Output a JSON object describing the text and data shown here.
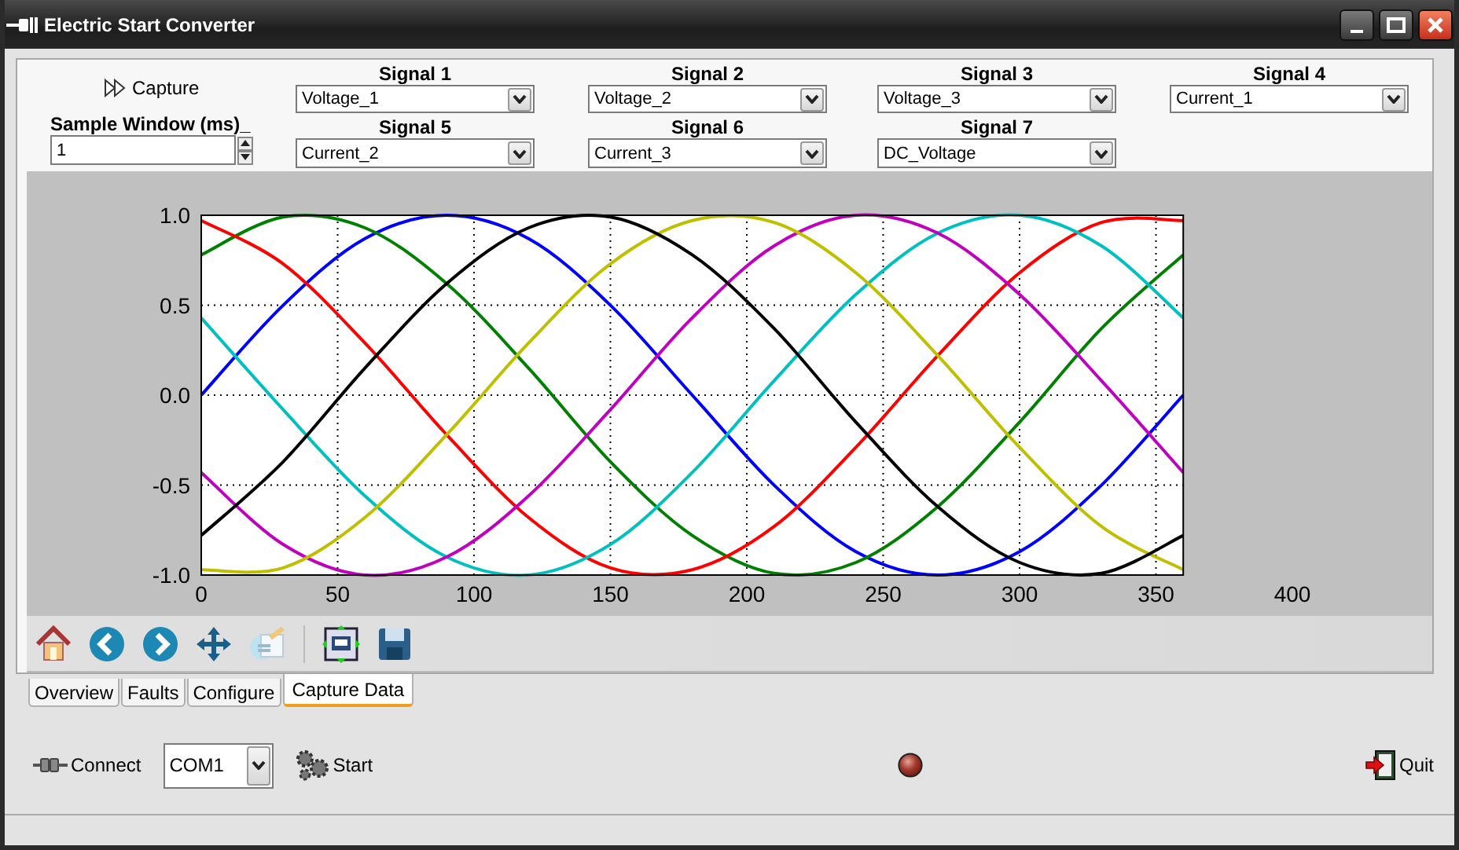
{
  "window": {
    "title": "Electric Start Converter"
  },
  "capture": {
    "label": "Capture"
  },
  "sample_window": {
    "label": "Sample Window (ms)_",
    "value": "1"
  },
  "signals": [
    {
      "label": "Signal 1",
      "value": "Voltage_1"
    },
    {
      "label": "Signal 2",
      "value": "Voltage_2"
    },
    {
      "label": "Signal 3",
      "value": "Voltage_3"
    },
    {
      "label": "Signal 4",
      "value": "Current_1"
    },
    {
      "label": "Signal 5",
      "value": "Current_2"
    },
    {
      "label": "Signal 6",
      "value": "Current_3"
    },
    {
      "label": "Signal 7",
      "value": "DC_Voltage"
    }
  ],
  "chart_data": {
    "type": "line",
    "grid": true,
    "x": [
      0,
      30,
      60,
      90,
      120,
      150,
      180,
      210,
      240,
      270,
      300,
      330,
      360
    ],
    "xlim": [
      0,
      400
    ],
    "ylim": [
      -1,
      1
    ],
    "xticks": [
      0,
      50,
      100,
      150,
      200,
      250,
      300,
      350,
      400
    ],
    "yticks": [
      {
        "value": -1,
        "label": "-1.0"
      },
      {
        "value": -0.5,
        "label": "-0.5"
      },
      {
        "value": 0,
        "label": "0.0"
      },
      {
        "value": 0.5,
        "label": "0.5"
      },
      {
        "value": 1,
        "label": "1.0"
      }
    ],
    "series": [
      {
        "color": "#0000ff",
        "values": [
          0,
          0.5,
          0.87,
          1,
          0.87,
          0.5,
          0,
          -0.5,
          -0.87,
          -1,
          -0.87,
          -0.5,
          0
        ]
      },
      {
        "color": "#008000",
        "values": [
          0.78,
          0.99,
          0.93,
          0.62,
          0.15,
          -0.37,
          -0.78,
          -0.99,
          -0.93,
          -0.62,
          -0.15,
          0.37,
          0.78
        ]
      },
      {
        "color": "#ff0000",
        "values": [
          0.97,
          0.73,
          0.29,
          -0.22,
          -0.68,
          -0.96,
          -0.97,
          -0.73,
          -0.29,
          0.22,
          0.68,
          0.96,
          0.97
        ]
      },
      {
        "color": "#00bfbf",
        "values": [
          0.43,
          -0.08,
          -0.56,
          -0.9,
          -1,
          -0.83,
          -0.43,
          0.08,
          0.56,
          0.9,
          1,
          0.83,
          0.43
        ]
      },
      {
        "color": "#bf00bf",
        "values": [
          -0.43,
          -0.83,
          -1,
          -0.9,
          -0.56,
          -0.08,
          0.43,
          0.83,
          1,
          0.9,
          0.56,
          0.08,
          -0.43
        ]
      },
      {
        "color": "#bfbf00",
        "values": [
          -0.97,
          -0.96,
          -0.68,
          -0.22,
          0.29,
          0.73,
          0.97,
          0.96,
          0.68,
          0.22,
          -0.29,
          -0.73,
          -0.97
        ]
      },
      {
        "color": "#000000",
        "values": [
          -0.78,
          -0.37,
          0.15,
          0.62,
          0.93,
          0.99,
          0.78,
          0.37,
          -0.15,
          -0.62,
          -0.93,
          -0.99,
          -0.78
        ]
      }
    ]
  },
  "tabs": [
    {
      "label": "Overview",
      "selected": false
    },
    {
      "label": "Faults",
      "selected": false
    },
    {
      "label": "Configure",
      "selected": false
    },
    {
      "label": "Capture Data",
      "selected": true
    }
  ],
  "connect": {
    "label": "Connect"
  },
  "port": {
    "value": "COM1"
  },
  "start": {
    "label": "Start"
  },
  "quit": {
    "label": "Quit"
  }
}
